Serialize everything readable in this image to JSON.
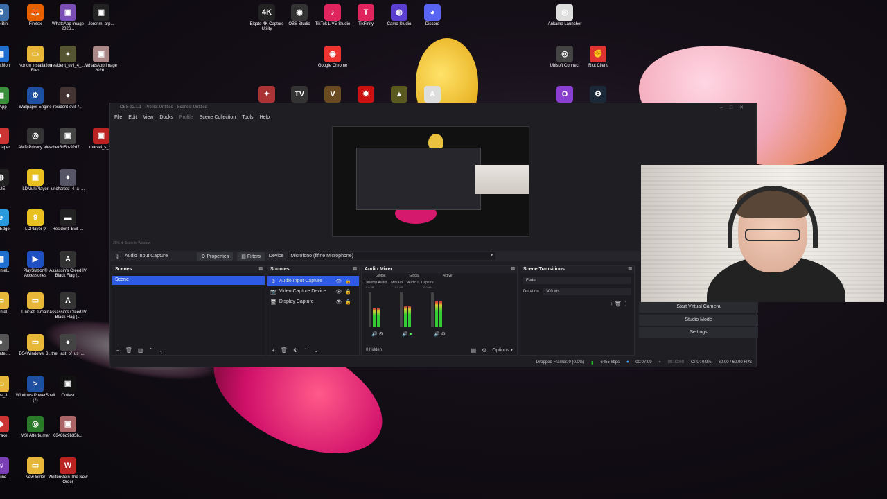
{
  "desktop": {
    "icons": [
      {
        "label": "rcle Bin",
        "bg": "#3b6ea8",
        "glyph": "♻"
      },
      {
        "label": "Firefox",
        "bg": "#e66000",
        "glyph": "🦊"
      },
      {
        "label": "WhatsApp Image 2026...",
        "bg": "#7a4fb5",
        "glyph": "▣"
      },
      {
        "label": "/lorenm_arp...",
        "bg": "#222",
        "glyph": "▣"
      },
      {
        "label": "esentMon",
        "bg": "#1f6fd1",
        "glyph": "▦"
      },
      {
        "label": "Norton Installation Files",
        "bg": "#e7b73a",
        "glyph": "▭"
      },
      {
        "label": "resident_evil_4_...",
        "bg": "#553",
        "glyph": "●"
      },
      {
        "label": "WhatsApp Image 2026...",
        "bg": "#a88",
        "glyph": "▣"
      },
      {
        "label": "IA App",
        "bg": "#3a8f3a",
        "glyph": "▦"
      },
      {
        "label": "Wallpaper Engine",
        "bg": "#1f4fa0",
        "glyph": "⚙"
      },
      {
        "label": "resident-evil-7...",
        "bg": "#433",
        "glyph": "●"
      },
      {
        "label": "Wallpaper",
        "bg": "#c33",
        "glyph": "◐"
      },
      {
        "label": "AMD Privacy View",
        "bg": "#333",
        "glyph": "◎"
      },
      {
        "label": "bek3d5h-92d7...",
        "bg": "#444",
        "glyph": "▣"
      },
      {
        "label": "marvel_s_sp",
        "bg": "#b22",
        "glyph": "▣"
      },
      {
        "label": "CUE",
        "bg": "#222",
        "glyph": "◍"
      },
      {
        "label": "LDMultiPlayer",
        "bg": "#e8c020",
        "glyph": "▣"
      },
      {
        "label": "uncharted_4_a_...",
        "bg": "#556",
        "glyph": "●"
      },
      {
        "label": "soft Edge",
        "bg": "#2a9adf",
        "glyph": "e"
      },
      {
        "label": "LDPlayer 9",
        "bg": "#e8c020",
        "glyph": "9"
      },
      {
        "label": "Resident_Evil_...",
        "bg": "#222",
        "glyph": "▬"
      },
      {
        "label": "AN_Intel...",
        "bg": "#1f6fd1",
        "glyph": "▦"
      },
      {
        "label": "PlayStation® Accessories",
        "bg": "#1f4fc0",
        "glyph": "▶"
      },
      {
        "label": "Assassin's Creed IV Black Flag (...",
        "bg": "#333",
        "glyph": "A"
      },
      {
        "label": "AN_Intel...",
        "bg": "#e7b73a",
        "glyph": "▭"
      },
      {
        "label": "UniGetUI-main",
        "bg": "#e7b73a",
        "glyph": "▭"
      },
      {
        "label": "Assassin's Creed IV Black Flag (...",
        "bg": "#333",
        "glyph": "A"
      },
      {
        "label": "ryCratel...",
        "bg": "#555",
        "glyph": "●"
      },
      {
        "label": "D54Windows_3...",
        "bg": "#e7b73a",
        "glyph": "▭"
      },
      {
        "label": "the_last_of_us_...",
        "bg": "#444",
        "glyph": "●"
      },
      {
        "label": "ndows_3...",
        "bg": "#e7b73a",
        "glyph": "▭"
      },
      {
        "label": "Windows PowerShell (2)",
        "bg": "#1f4fa0",
        "glyph": ">"
      },
      {
        "label": "Outlast",
        "bg": "#111",
        "glyph": "▣"
      },
      {
        "label": "dBrake",
        "bg": "#c33",
        "glyph": "◆"
      },
      {
        "label": "MSI Afterburner",
        "bg": "#2a7a2a",
        "glyph": "◎"
      },
      {
        "label": "63486d9b35b...",
        "bg": "#a66",
        "glyph": "▣"
      },
      {
        "label": "t Tune",
        "bg": "#7a3fb5",
        "glyph": "♫"
      },
      {
        "label": "New folder",
        "bg": "#e7b73a",
        "glyph": "▭"
      },
      {
        "label": "Wolfenstein The New Order",
        "bg": "#b22",
        "glyph": "W"
      },
      {
        "label": "Elgato 4K Capture Utility",
        "bg": "#222",
        "glyph": "4K"
      },
      {
        "label": "OBS Studio",
        "bg": "#333",
        "glyph": "◉"
      },
      {
        "label": "TikTok LIVE Studio",
        "bg": "#e0245e",
        "glyph": "♪"
      },
      {
        "label": "TikFinity",
        "bg": "#e0245e",
        "glyph": "T"
      },
      {
        "label": "Camo Studio",
        "bg": "#5b3fd1",
        "glyph": "◍"
      },
      {
        "label": "Discord",
        "bg": "#5865f2",
        "glyph": "◕"
      },
      {
        "label": "Ankama Launcher",
        "bg": "#ddd",
        "glyph": "◎"
      },
      {
        "label": "Google Chrome",
        "bg": "#e33",
        "glyph": "◉"
      },
      {
        "label": "Ubisoft Connect",
        "bg": "#444",
        "glyph": "◎"
      },
      {
        "label": "Riot Client",
        "bg": "#d33",
        "glyph": "✊"
      },
      {
        "label": "",
        "bg": "#a33",
        "glyph": "✦"
      },
      {
        "label": "",
        "bg": "#333",
        "glyph": "TV"
      },
      {
        "label": "",
        "bg": "#6a4a20",
        "glyph": "V"
      },
      {
        "label": "",
        "bg": "#c11",
        "glyph": "✹"
      },
      {
        "label": "",
        "bg": "#5a5a20",
        "glyph": "▲"
      },
      {
        "label": "",
        "bg": "#ddd",
        "glyph": "A"
      },
      {
        "label": "",
        "bg": "#8a3fd1",
        "glyph": "O"
      },
      {
        "label": "",
        "bg": "#1b2838",
        "glyph": "⚙"
      }
    ]
  },
  "obs": {
    "title": "OBS 32.1.1 - Profile: Untitled - Scenes: Untitled",
    "menu": [
      "File",
      "Edit",
      "View",
      "Docks",
      "Profile",
      "Scene Collection",
      "Tools",
      "Help"
    ],
    "zoom_label": "25%  ✥  Scale to Window",
    "source_bar": {
      "selected_source": "Audio Input Capture",
      "properties": "Properties",
      "filters": "Filters",
      "device_label": "Device",
      "device_value": "Micrófono (fifine Microphone)"
    },
    "scenes": {
      "title": "Scenes",
      "items": [
        "Scene"
      ]
    },
    "sources": {
      "title": "Sources",
      "items": [
        "Audio Input Capture",
        "Video Capture Device",
        "Display Capture"
      ]
    },
    "mixer": {
      "title": "Audio Mixer",
      "global": "Global",
      "active": "Active",
      "channels": [
        {
          "name": "Desktop Audio",
          "db": "0.0 dB",
          "level": 0.55
        },
        {
          "name": "Mic/Aux",
          "db": "0.0 dB",
          "level": 0.6
        },
        {
          "name": "Audio I...Capture",
          "db": "0.0 dB",
          "level": 0.75
        }
      ],
      "hidden": "0 hidden",
      "options": "Options"
    },
    "transitions": {
      "title": "Scene Transitions",
      "value": "Fade",
      "duration_label": "Duration",
      "duration_value": "300 ms"
    },
    "controls": {
      "virtual_camera": "Start Virtual Camera",
      "studio_mode": "Studio Mode",
      "settings": "Settings"
    },
    "status": {
      "dropped": "Dropped Frames 0 (0.0%)",
      "bitrate": "6455 kbps",
      "rec_time": "00:07:09",
      "stream_time": "00:00:00",
      "cpu": "CPU: 0.9%",
      "fps": "60.00 / 60.00 FPS"
    }
  }
}
